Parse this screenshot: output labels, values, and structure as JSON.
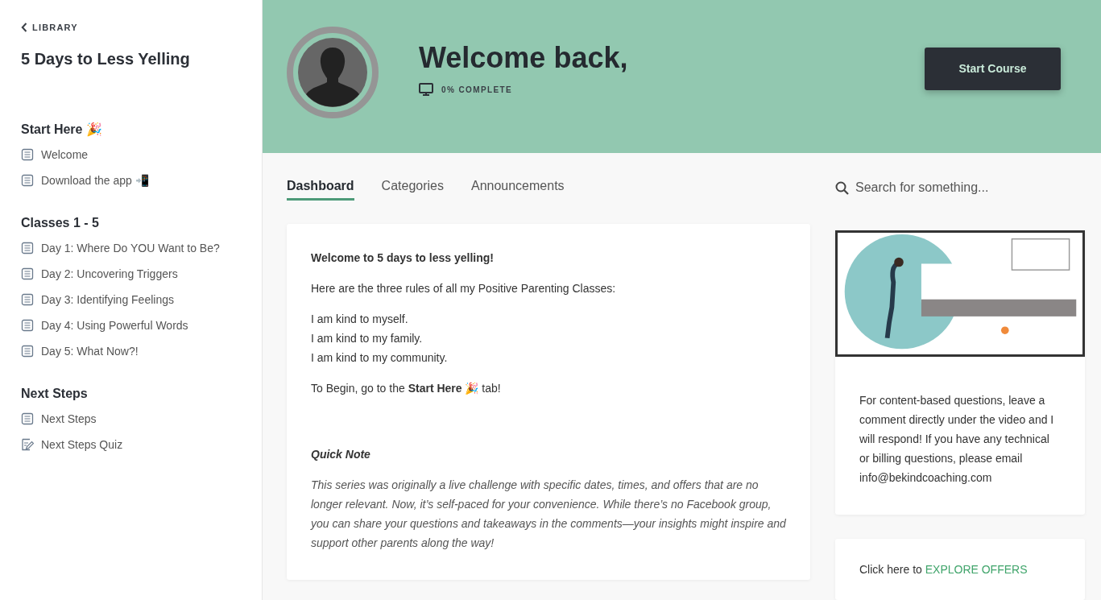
{
  "sidebar": {
    "back_link": "LIBRARY",
    "course_title": "5 Days to Less Yelling",
    "sections": [
      {
        "title": "Start Here 🎉",
        "items": [
          {
            "kind": "lesson",
            "label": "Welcome"
          },
          {
            "kind": "lesson",
            "label": "Download the app 📲"
          }
        ]
      },
      {
        "title": "Classes 1 - 5",
        "items": [
          {
            "kind": "lesson",
            "label": "Day 1: Where Do YOU Want to Be?"
          },
          {
            "kind": "lesson",
            "label": "Day 2: Uncovering Triggers"
          },
          {
            "kind": "lesson",
            "label": "Day 3: Identifying Feelings"
          },
          {
            "kind": "lesson",
            "label": "Day 4: Using Powerful Words"
          },
          {
            "kind": "lesson",
            "label": "Day 5: What Now?!"
          }
        ]
      },
      {
        "title": "Next Steps",
        "items": [
          {
            "kind": "lesson",
            "label": "Next Steps"
          },
          {
            "kind": "quiz",
            "label": "Next Steps Quiz"
          }
        ]
      }
    ]
  },
  "header": {
    "greeting": "Welcome back,",
    "progress": "0% COMPLETE",
    "button": "Start Course"
  },
  "tabs": [
    {
      "label": "Dashboard",
      "selected": true
    },
    {
      "label": "Categories",
      "selected": false
    },
    {
      "label": "Announcements",
      "selected": false
    }
  ],
  "search": {
    "placeholder": "Search for something..."
  },
  "welcome_card": {
    "heading": "Welcome to 5 days to less yelling!",
    "intro": "Here are the three rules of all my Positive Parenting Classes:",
    "rules": [
      "I am kind to myself.",
      "I am kind to my family.",
      "I am kind to my community."
    ],
    "begin": "To Begin, go to the **Start Here 🎉** tab!",
    "note_title": "Quick Note",
    "note": "This series was originally a live challenge with specific dates, times, and offers that are no longer relevant. Now, it’s self-paced for your convenience. While there’s no Facebook group, you can share your questions and takeaways in the comments—your insights might inspire and support other parents along the way!"
  },
  "info_card": {
    "text": "For content-based questions, leave a comment directly under the video and I will respond! If you have any technical or billing questions, please email info@bekindcoaching.com"
  },
  "offers_card": {
    "prefix": "Click here to",
    "link": "EXPLORE OFFERS"
  }
}
